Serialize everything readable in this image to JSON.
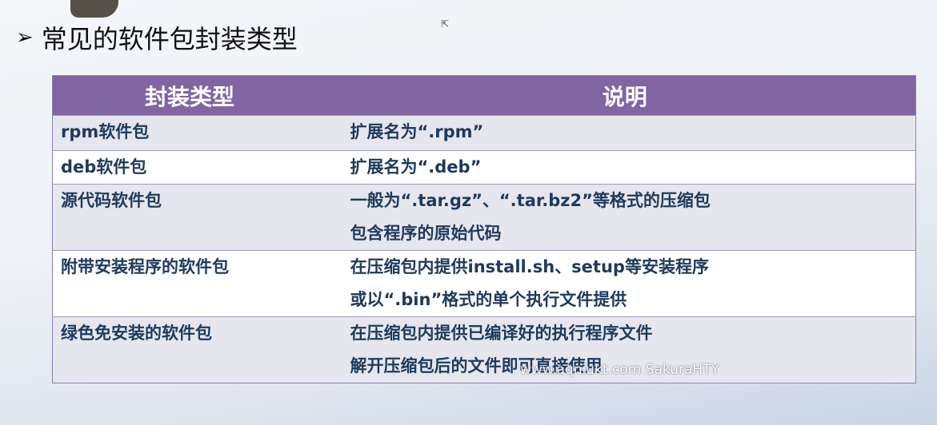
{
  "slide": {
    "title_bullet": "➢",
    "title": "常见的软件包封装类型",
    "watermark": "www.aqniukt.com SakuraHTY"
  },
  "table": {
    "headers": [
      "封装类型",
      "说明"
    ],
    "rows": [
      {
        "type": "rpm软件包",
        "desc": [
          "扩展名为“.rpm”"
        ]
      },
      {
        "type": "deb软件包",
        "desc": [
          "扩展名为“.deb”"
        ]
      },
      {
        "type": "源代码软件包",
        "desc": [
          "一般为“.tar.gz”、“.tar.bz2”等格式的压缩包",
          "包含程序的原始代码"
        ]
      },
      {
        "type": "附带安装程序的软件包",
        "desc": [
          "在压缩包内提供install.sh、setup等安装程序",
          "或以“.bin”格式的单个执行文件提供"
        ]
      },
      {
        "type": "绿色免安装的软件包",
        "desc": [
          "在压缩包内提供已编译好的执行程序文件",
          "解开压缩包后的文件即可直接使用"
        ]
      }
    ]
  }
}
